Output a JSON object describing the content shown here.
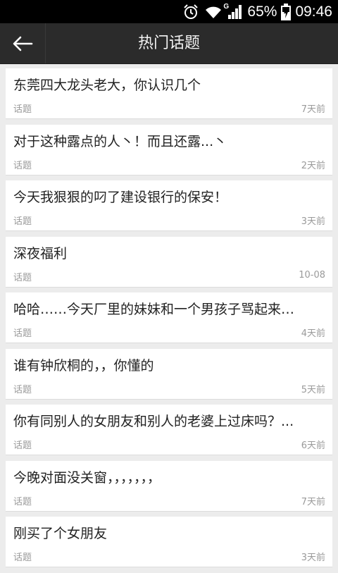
{
  "status_bar": {
    "battery_percent": "65%",
    "time": "09:46",
    "network_label": "G",
    "icons": [
      "alarm-icon",
      "wifi-icon",
      "signal-icon",
      "battery-charging-icon"
    ]
  },
  "app_bar": {
    "title": "热门话题",
    "back_icon": "arrow-left-icon"
  },
  "topics": [
    {
      "title": "东莞四大龙头老大，你认识几个",
      "tag": "话题",
      "time": "7天前"
    },
    {
      "title": "对于这种露点的人丶！而且还露...丶",
      "tag": "话题",
      "time": "2天前"
    },
    {
      "title": "今天我狠狠的叼了建设银行的保安！",
      "tag": "话题",
      "time": "3天前"
    },
    {
      "title": "深夜福利",
      "tag": "话题",
      "time": "10-08"
    },
    {
      "title": "哈哈……今天厂里的妹妹和一个男孩子骂起来…",
      "tag": "话题",
      "time": "4天前"
    },
    {
      "title": "谁有钟欣桐的，，你懂的",
      "tag": "话题",
      "time": "5天前"
    },
    {
      "title": "你有同别人的女朋友和别人的老婆上过床吗？...",
      "tag": "话题",
      "time": "6天前"
    },
    {
      "title": "今晚对面没关窗，，，，，，，",
      "tag": "话题",
      "time": "7天前"
    },
    {
      "title": "刚买了个女朋友",
      "tag": "话题",
      "time": "3天前"
    }
  ]
}
